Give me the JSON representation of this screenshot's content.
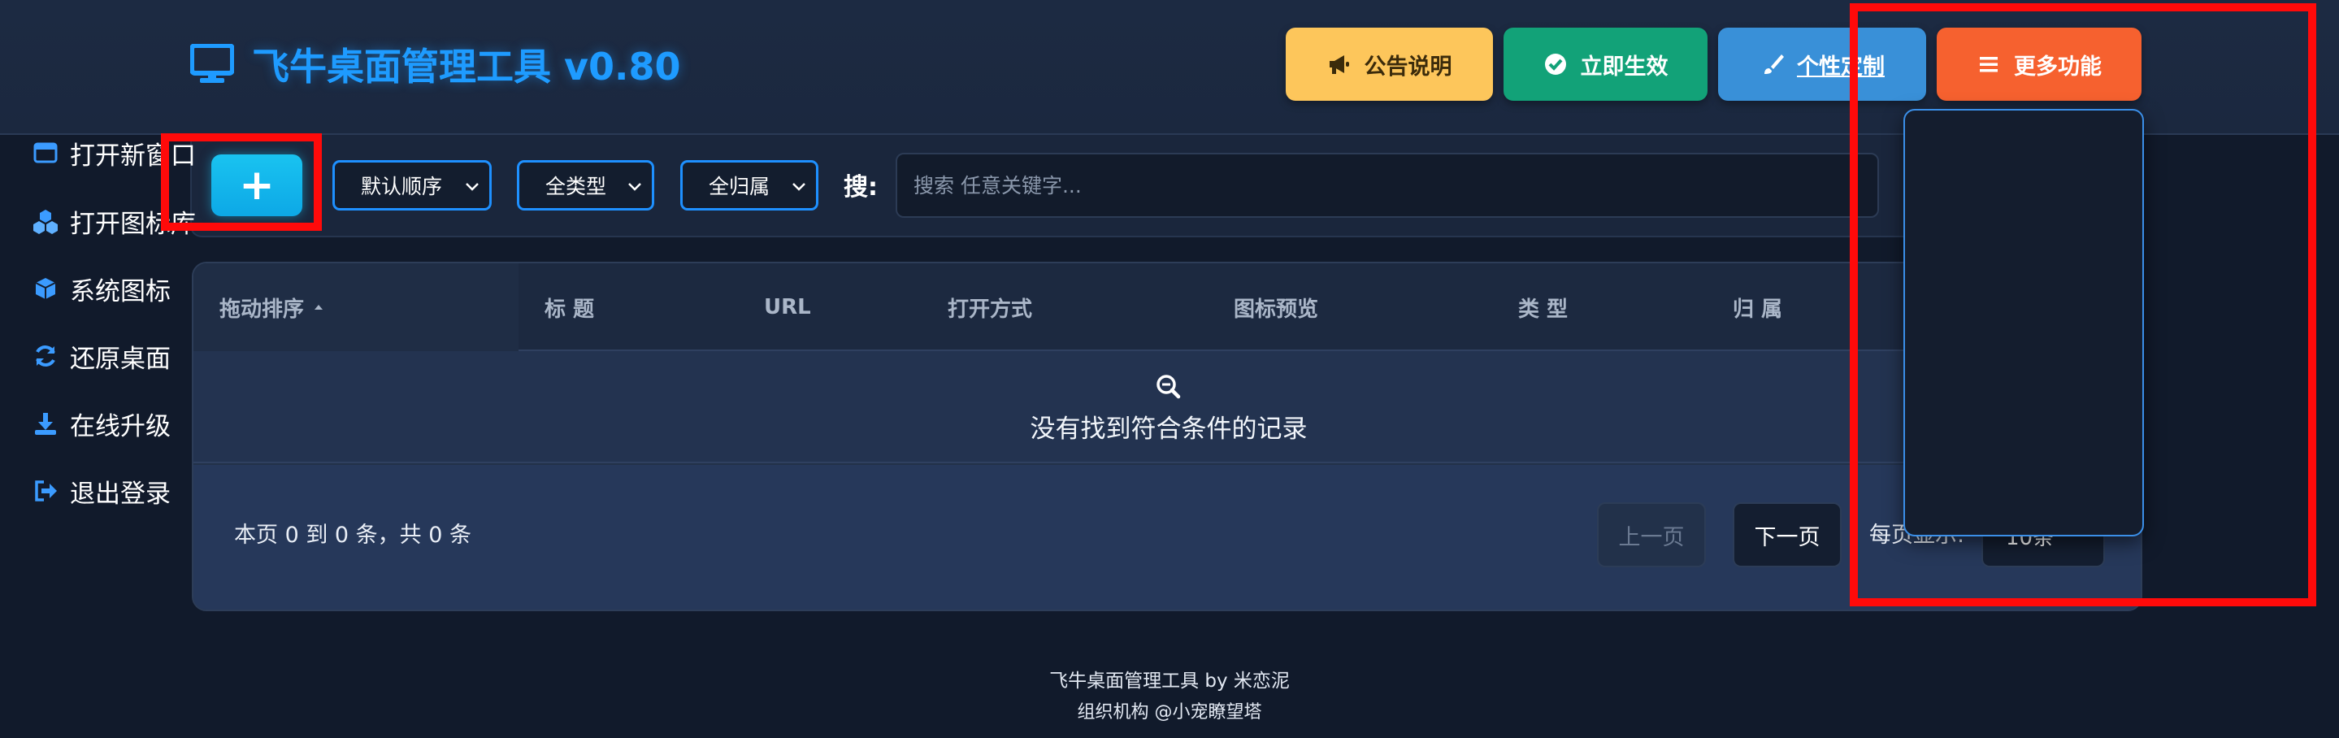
{
  "header": {
    "title": "飞牛桌面管理工具 v0.80",
    "buttons": {
      "announce": "公告说明",
      "apply": "立即生效",
      "customize": "个性定制",
      "more": "更多功能"
    }
  },
  "toolbar": {
    "add_label": "+",
    "order_select": "默认顺序",
    "type_select": "全类型",
    "owner_select": "全归属",
    "search_label": "搜:",
    "search_placeholder": "搜索 任意关键字..."
  },
  "table": {
    "columns": [
      "拖动排序",
      "标 题",
      "URL",
      "打开方式",
      "图标预览",
      "类 型",
      "归 属"
    ],
    "empty_text": "没有找到符合条件的记录",
    "page_info": "本页 0 到 0 条，共 0 条",
    "prev": "上一页",
    "next": "下一页",
    "per_page_label": "每页显示:",
    "per_page_value": "10条"
  },
  "dropdown": {
    "items": [
      "打开新窗口",
      "打开图标库",
      "系统图标",
      "还原桌面",
      "在线升级",
      "退出登录"
    ]
  },
  "footer": {
    "line1": "飞牛桌面管理工具 by 米恋泥",
    "line2": "组织机构 @小宠瞭望塔"
  },
  "colors": {
    "title": "#1e9bff",
    "announce": "#fdc65b",
    "apply": "#12a278",
    "customize": "#3990d8",
    "more": "#f6612f",
    "add": "#19c3f0",
    "annotation": "#ff0a0a"
  },
  "icons": {
    "title": "monitor-icon",
    "announce": "megaphone-icon",
    "apply": "check-circle-icon",
    "customize": "brush-icon",
    "more": "menu-lines-icon",
    "empty": "zoom-out-icon"
  }
}
